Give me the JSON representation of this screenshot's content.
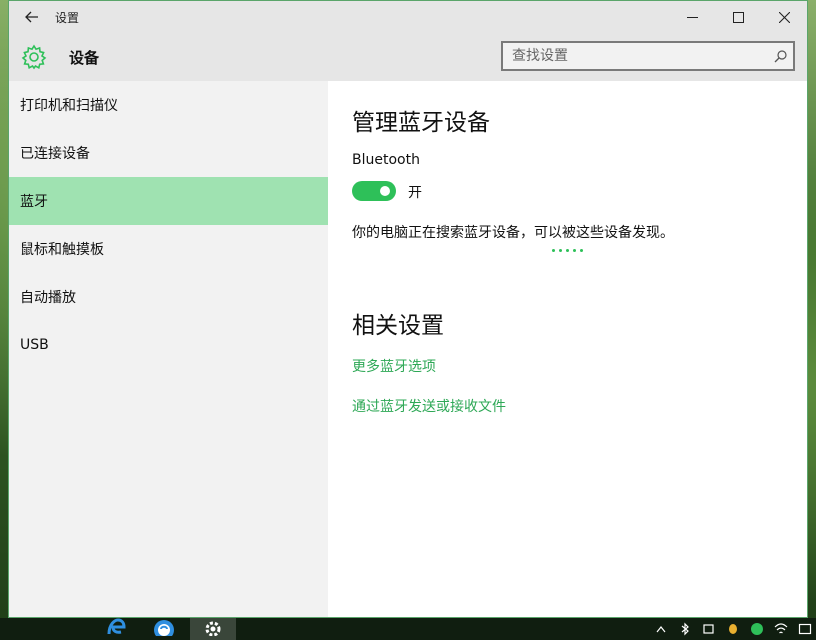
{
  "window": {
    "title": "设置"
  },
  "header": {
    "title": "设备"
  },
  "search": {
    "placeholder": "查找设置"
  },
  "sidebar": {
    "items": [
      {
        "label": "打印机和扫描仪"
      },
      {
        "label": "已连接设备"
      },
      {
        "label": "蓝牙",
        "active": true
      },
      {
        "label": "鼠标和触摸板"
      },
      {
        "label": "自动播放"
      },
      {
        "label": "USB"
      }
    ]
  },
  "content": {
    "title": "管理蓝牙设备",
    "bluetooth_label": "Bluetooth",
    "toggle_state": "开",
    "scanning_text": "你的电脑正在搜索蓝牙设备，可以被这些设备发现。",
    "related_title": "相关设置",
    "links": [
      {
        "label": "更多蓝牙选项"
      },
      {
        "label": "通过蓝牙发送或接收文件"
      }
    ]
  },
  "colors": {
    "accent": "#2ec059",
    "link": "#2ea856",
    "active_nav": "#9fe2b1",
    "chrome": "#e6e6e6",
    "sidebar": "#f2f2f2"
  },
  "icons": {
    "back": "back-arrow-icon",
    "minimize": "minimize-icon",
    "maximize": "maximize-icon",
    "close": "close-icon",
    "header": "gear-icon",
    "search": "search-icon"
  }
}
